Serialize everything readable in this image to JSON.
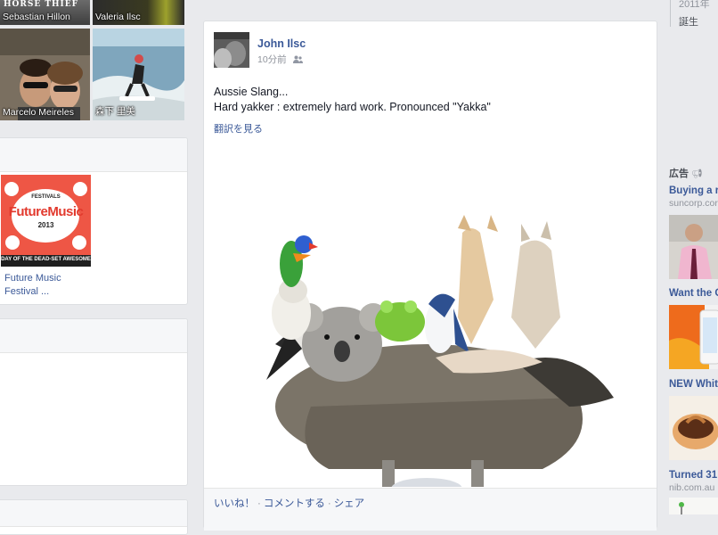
{
  "friends": {
    "tiles": [
      {
        "name": "Sebastian Hillon"
      },
      {
        "name": "Valeria Ilsc"
      },
      {
        "name": "Marcelo Meireles"
      },
      {
        "name": "森下 里美"
      }
    ],
    "top_tile_caption": "HORSE THIEF"
  },
  "likes": {
    "page_logo_top": "FESTIVALS",
    "page_logo_main": "FutureMusic",
    "page_logo_year": "2013",
    "page_logo_tagline": "DAY OF THE DEAD-SET AWESOME",
    "page_name": "Future Music Festival ..."
  },
  "post": {
    "author": "John Ilsc",
    "time": "10分前",
    "audience_icon": "friends-icon",
    "text_line1": "Aussie Slang...",
    "text_line2": "Hard yakker : extremely hard work. Pronounced \"Yakka\"",
    "translate": "翻訳を見る",
    "actions": {
      "like": "いいね！",
      "comment": "コメントする",
      "share": "シェア"
    }
  },
  "right": {
    "timeline_year": "2011年",
    "timeline_birth": "誕生",
    "ads_header": "広告",
    "ads": [
      {
        "title": "Buying a r",
        "domain": "suncorp.cor"
      },
      {
        "title": "Want the C",
        "domain": ""
      },
      {
        "title": "NEW Whit",
        "domain": ""
      },
      {
        "title": "Turned 31",
        "domain": "nib.com.au"
      }
    ]
  }
}
